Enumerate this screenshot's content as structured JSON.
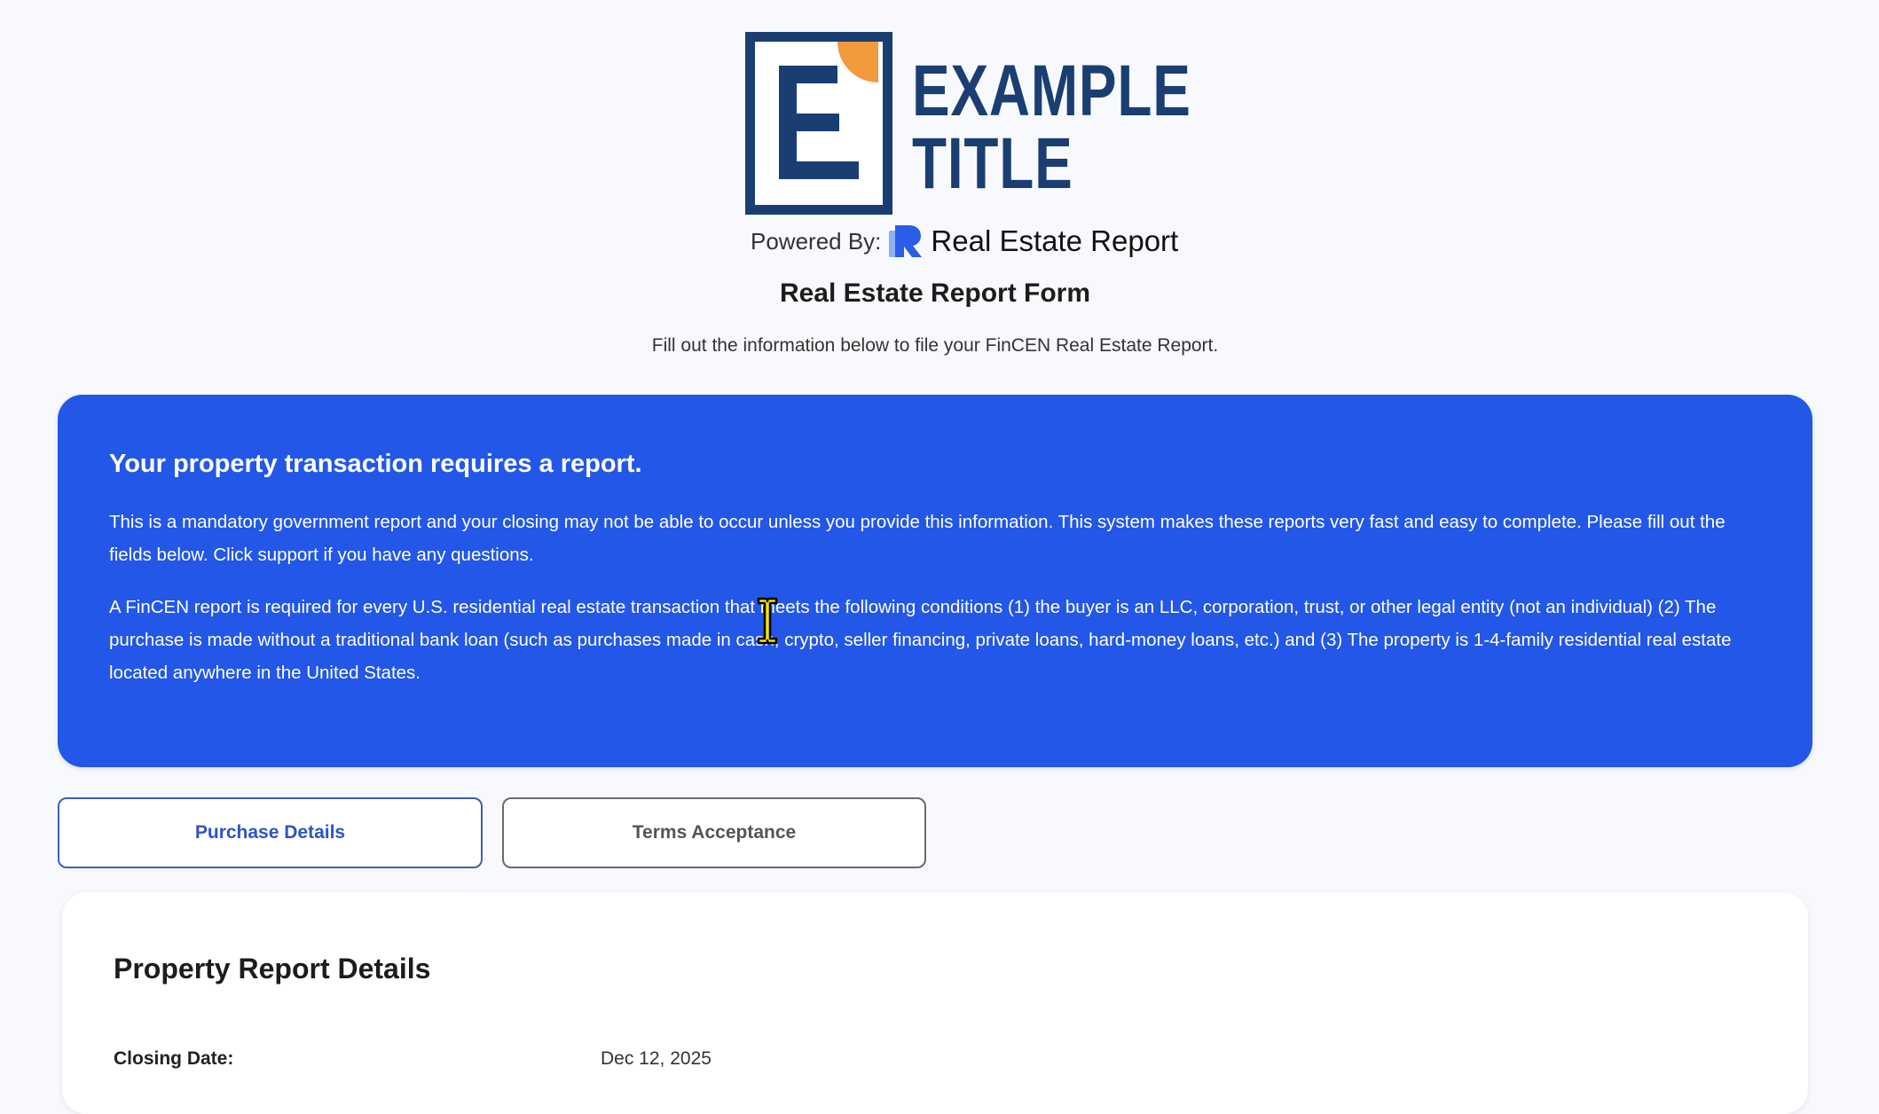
{
  "logo": {
    "line1": "EXAMPLE",
    "line2": "TITLE",
    "accent_color": "#f39a3c",
    "brand_color": "#1b3e72"
  },
  "powered_by": {
    "label": "Powered By:",
    "brand": "Real Estate Report",
    "icon": "real-estate-report-logo-icon"
  },
  "form": {
    "title": "Real Estate Report Form",
    "subtitle": "Fill out the information below to file your FinCEN Real Estate Report."
  },
  "notice": {
    "heading": "Your property transaction requires a report.",
    "paragraph1": "This is a mandatory government report and your closing may not be able to occur unless you provide this information. This system makes these reports very fast and easy to complete. Please fill out the fields below. Click support if you have any questions.",
    "paragraph2": "A FinCEN report is required for every U.S. residential real estate transaction that meets the following conditions (1) the buyer is an LLC, corporation, trust, or other legal entity (not an individual) (2) The purchase is made without a traditional bank loan (such as purchases made in cash, crypto, seller financing, private loans, hard-money loans, etc.) and (3) The property is 1-4-family residential real estate located anywhere in the United States.",
    "background_color": "#2257e7"
  },
  "tabs": [
    {
      "label": "Purchase Details",
      "active": true
    },
    {
      "label": "Terms Acceptance",
      "active": false
    }
  ],
  "details": {
    "title": "Property Report Details",
    "rows": [
      {
        "label": "Closing Date:",
        "value": "Dec 12, 2025"
      }
    ]
  }
}
